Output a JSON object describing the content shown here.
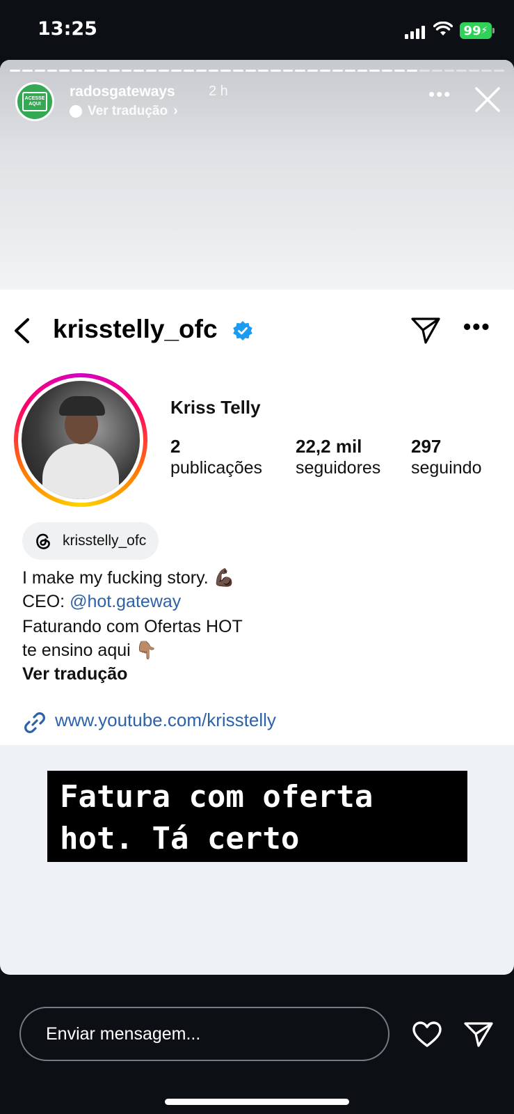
{
  "status_bar": {
    "time": "13:25",
    "battery": "99"
  },
  "story": {
    "username": "radosgateways",
    "time_ago": "2 h",
    "translate_label": "Ver tradução",
    "logo_text": "ACESSE AQUI"
  },
  "profile": {
    "username": "krisstelly_ofc",
    "display_name": "Kriss Telly",
    "stats": [
      {
        "value": "2",
        "label": "publicações"
      },
      {
        "value": "22,2 mil",
        "label": "seguidores"
      },
      {
        "value": "297",
        "label": "seguindo"
      }
    ],
    "threads_handle": "krisstelly_ofc",
    "bio": {
      "line1": "I make my fucking story. 💪🏿",
      "line2_prefix": "CEO: ",
      "line2_mention": "@hot.gateway",
      "line3": "Faturando com Ofertas HOT",
      "line4": "te ensino aqui 👇🏽",
      "translate": "Ver tradução"
    },
    "link": "www.youtube.com/krisstelly"
  },
  "caption": {
    "line1": "Fatura com oferta",
    "line2": "hot. Tá certo"
  },
  "footer": {
    "message_placeholder": "Enviar mensagem..."
  },
  "colors": {
    "verified_badge": "#1d9bf0",
    "link": "#2d62a8",
    "story_avatar_bg": "#34a853"
  }
}
